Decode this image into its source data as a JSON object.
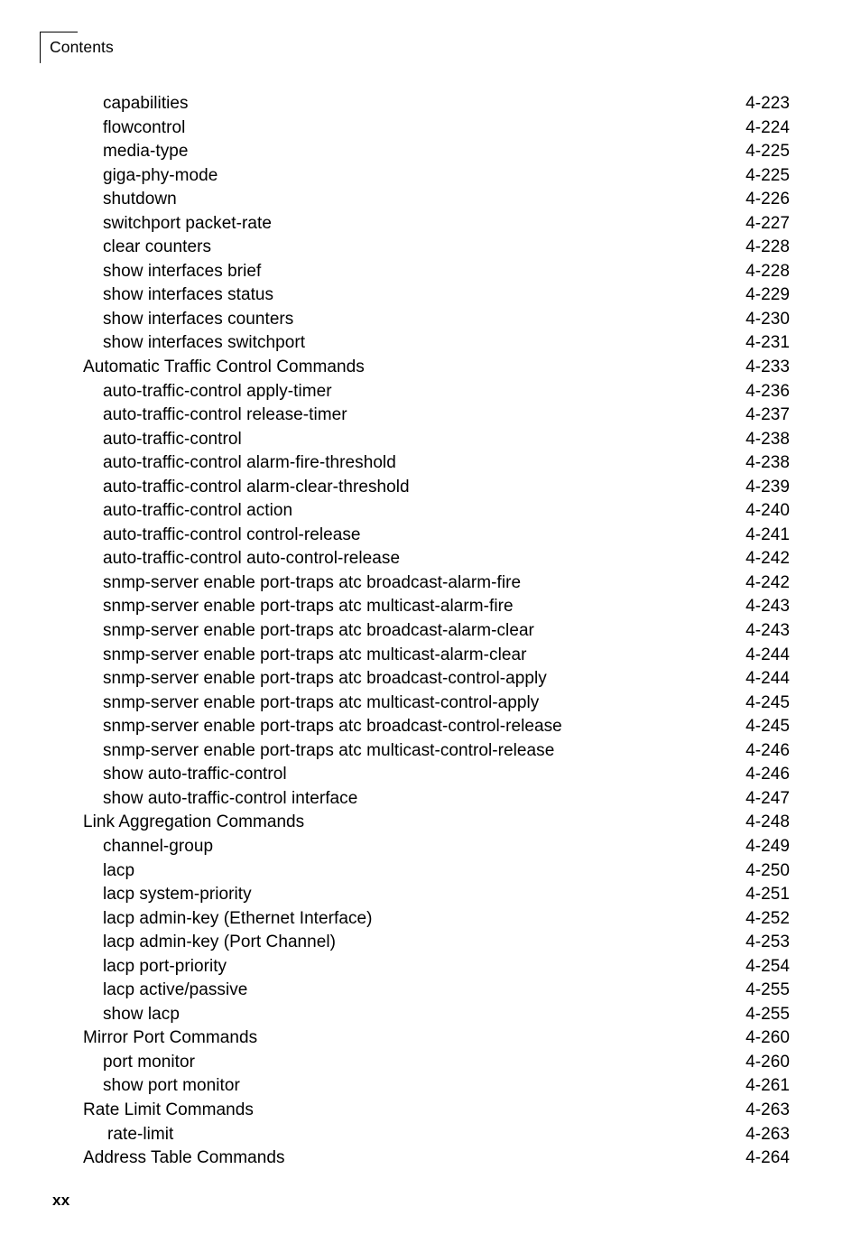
{
  "header": {
    "title": "Contents",
    "bracket_icon": "corner-bracket-icon"
  },
  "footer": {
    "page_number": "xx"
  },
  "toc": {
    "entries": [
      {
        "label": "capabilities",
        "page": "4-223",
        "level": 2
      },
      {
        "label": "flowcontrol",
        "page": "4-224",
        "level": 2
      },
      {
        "label": "media-type",
        "page": "4-225",
        "level": 2
      },
      {
        "label": "giga-phy-mode",
        "page": "4-225",
        "level": 2
      },
      {
        "label": "shutdown",
        "page": "4-226",
        "level": 2
      },
      {
        "label": "switchport packet-rate",
        "page": "4-227",
        "level": 2
      },
      {
        "label": "clear counters",
        "page": "4-228",
        "level": 2
      },
      {
        "label": "show interfaces brief",
        "page": "4-228",
        "level": 2
      },
      {
        "label": "show interfaces status",
        "page": "4-229",
        "level": 2
      },
      {
        "label": "show interfaces counters",
        "page": "4-230",
        "level": 2
      },
      {
        "label": "show interfaces switchport",
        "page": "4-231",
        "level": 2
      },
      {
        "label": "Automatic Traffic Control Commands",
        "page": "4-233",
        "level": 1
      },
      {
        "label": "auto-traffic-control apply-timer",
        "page": "4-236",
        "level": 2
      },
      {
        "label": "auto-traffic-control release-timer",
        "page": "4-237",
        "level": 2
      },
      {
        "label": "auto-traffic-control",
        "page": "4-238",
        "level": 2
      },
      {
        "label": "auto-traffic-control alarm-fire-threshold",
        "page": "4-238",
        "level": 2
      },
      {
        "label": "auto-traffic-control alarm-clear-threshold",
        "page": "4-239",
        "level": 2
      },
      {
        "label": "auto-traffic-control action",
        "page": "4-240",
        "level": 2
      },
      {
        "label": "auto-traffic-control control-release",
        "page": "4-241",
        "level": 2
      },
      {
        "label": "auto-traffic-control auto-control-release",
        "page": "4-242",
        "level": 2
      },
      {
        "label": "snmp-server enable port-traps atc broadcast-alarm-fire",
        "page": "4-242",
        "level": 2
      },
      {
        "label": "snmp-server enable port-traps atc multicast-alarm-fire",
        "page": "4-243",
        "level": 2
      },
      {
        "label": "snmp-server enable port-traps atc broadcast-alarm-clear",
        "page": "4-243",
        "level": 2
      },
      {
        "label": "snmp-server enable port-traps atc multicast-alarm-clear",
        "page": "4-244",
        "level": 2
      },
      {
        "label": "snmp-server enable port-traps atc broadcast-control-apply",
        "page": "4-244",
        "level": 2
      },
      {
        "label": "snmp-server enable port-traps atc multicast-control-apply",
        "page": "4-245",
        "level": 2
      },
      {
        "label": "snmp-server enable port-traps atc broadcast-control-release",
        "page": "4-245",
        "level": 2
      },
      {
        "label": "snmp-server enable port-traps atc multicast-control-release",
        "page": "4-246",
        "level": 2
      },
      {
        "label": "show auto-traffic-control",
        "page": "4-246",
        "level": 2
      },
      {
        "label": "show auto-traffic-control interface",
        "page": "4-247",
        "level": 2
      },
      {
        "label": "Link Aggregation Commands",
        "page": "4-248",
        "level": 1
      },
      {
        "label": "channel-group",
        "page": "4-249",
        "level": 2
      },
      {
        "label": "lacp",
        "page": "4-250",
        "level": 2
      },
      {
        "label": "lacp system-priority",
        "page": "4-251",
        "level": 2
      },
      {
        "label": "lacp admin-key (Ethernet Interface)",
        "page": "4-252",
        "level": 2
      },
      {
        "label": "lacp admin-key (Port Channel)",
        "page": "4-253",
        "level": 2
      },
      {
        "label": "lacp port-priority",
        "page": "4-254",
        "level": 2
      },
      {
        "label": "lacp active/passive",
        "page": "4-255",
        "level": 2
      },
      {
        "label": "show lacp",
        "page": "4-255",
        "level": 2
      },
      {
        "label": "Mirror Port Commands",
        "page": "4-260",
        "level": 1
      },
      {
        "label": "port monitor",
        "page": "4-260",
        "level": 2
      },
      {
        "label": "show port monitor",
        "page": "4-261",
        "level": 2
      },
      {
        "label": "Rate Limit Commands",
        "page": "4-263",
        "level": 1
      },
      {
        "label": "rate-limit",
        "page": "4-263",
        "level": "2b"
      },
      {
        "label": "Address Table Commands",
        "page": "4-264",
        "level": 1
      }
    ]
  }
}
